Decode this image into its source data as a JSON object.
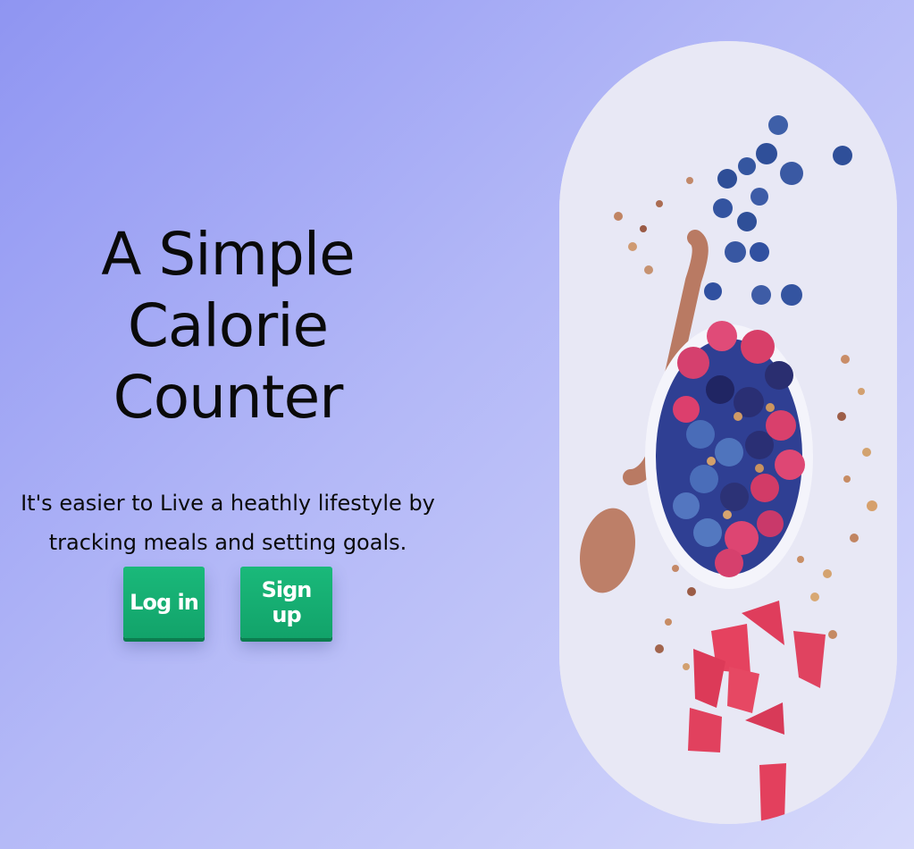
{
  "hero": {
    "title_line1": "A Simple Calorie",
    "title_line2": "Counter",
    "subtitle": "It's easier to Live a heathly lifestyle by tracking meals and setting goals."
  },
  "actions": {
    "login_label": "Log in",
    "signup_label": "Sign up"
  },
  "colors": {
    "background_start": "#8f95f2",
    "background_end": "#d6d9fb",
    "button": "#12a36a",
    "button_text": "#ffffff"
  }
}
